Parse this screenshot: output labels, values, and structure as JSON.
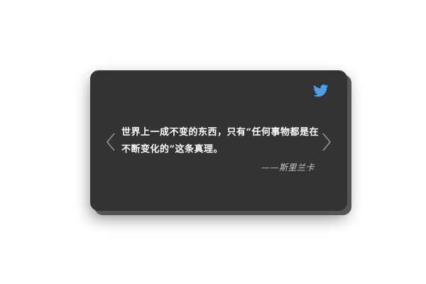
{
  "card": {
    "icon": "twitter-bird-icon",
    "quote": "世界上一成不变的东西，只有“任何事物都是在不断变化的”这条真理。",
    "author": "——斯里兰卡",
    "nav": {
      "prev_icon": "chevron-left-icon",
      "next_icon": "chevron-right-icon"
    }
  },
  "colors": {
    "card_background": "#333333",
    "quote_text": "#ffffff",
    "author_text": "#c8c8c8",
    "icon_accent": "#4a9fe8"
  }
}
